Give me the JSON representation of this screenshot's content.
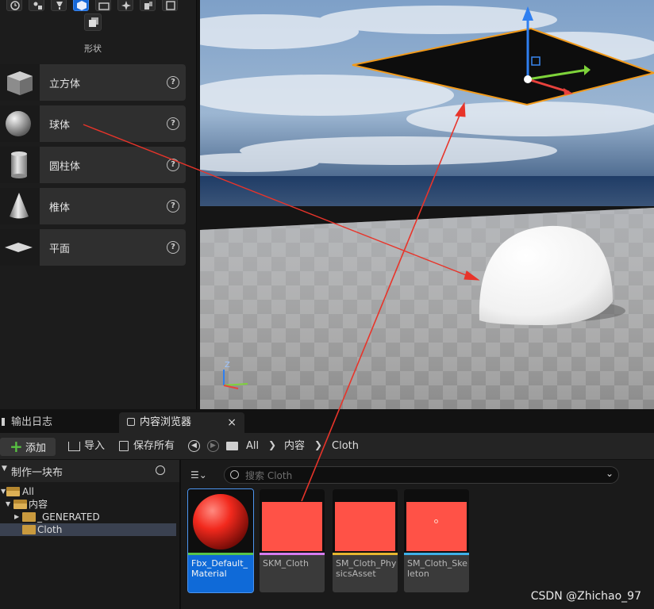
{
  "place_panel": {
    "category_label": "形状",
    "shapes": [
      {
        "label": "立方体",
        "icon": "cube-icon"
      },
      {
        "label": "球体",
        "icon": "sphere-icon"
      },
      {
        "label": "圆柱体",
        "icon": "cylinder-icon"
      },
      {
        "label": "椎体",
        "icon": "cone-icon"
      },
      {
        "label": "平面",
        "icon": "plane-icon"
      }
    ],
    "help_glyph": "?"
  },
  "viewport": {
    "axis_label_z": "Z",
    "gizmo_colors": {
      "x": "#e8423c",
      "y": "#7ed33a",
      "z": "#2f7ff0"
    },
    "selection_outline_color": "#f29a1a"
  },
  "annotation": {
    "arrow_color": "#e8342a"
  },
  "bottom_tabs": [
    {
      "label": "输出日志",
      "active": false
    },
    {
      "label": "内容浏览器",
      "active": true,
      "close": "×"
    }
  ],
  "toolbar": {
    "add_label": "添加",
    "import_label": "导入",
    "save_all_label": "保存所有",
    "breadcrumb": [
      "All",
      "内容",
      "Cloth"
    ]
  },
  "tree": {
    "header": "制作一块布",
    "items": [
      {
        "label": "All"
      },
      {
        "label": "内容"
      },
      {
        "label": "_GENERATED"
      },
      {
        "label": "Cloth",
        "selected": true
      }
    ]
  },
  "search": {
    "placeholder": "搜索 Cloth"
  },
  "assets": [
    {
      "name": "Fbx_Default_Material",
      "bar_color": "#57c44a",
      "selected": true
    },
    {
      "name": "SKM_Cloth",
      "bar_color": "#d67cf0",
      "selected": false
    },
    {
      "name": "SM_Cloth_PhysicsAsset",
      "bar_color": "#e7b62f",
      "selected": false
    },
    {
      "name": "SM_Cloth_Skeleton",
      "bar_color": "#3fb0e8",
      "selected": false
    }
  ],
  "watermark": "CSDN @Zhichao_97"
}
